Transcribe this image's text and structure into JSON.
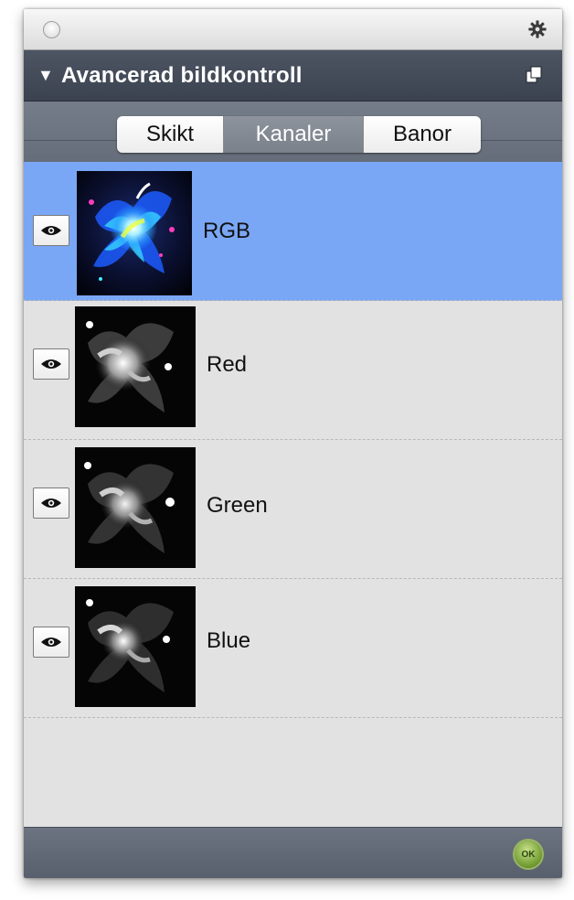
{
  "panel": {
    "title": "Avancerad bildkontroll",
    "ok_label": "OK"
  },
  "tabs": [
    {
      "label": "Skikt",
      "active": false
    },
    {
      "label": "Kanaler",
      "active": true
    },
    {
      "label": "Banor",
      "active": false
    }
  ],
  "channels": [
    {
      "label": "RGB",
      "visible": true,
      "selected": true
    },
    {
      "label": "Red",
      "visible": true,
      "selected": false
    },
    {
      "label": "Green",
      "visible": true,
      "selected": false
    },
    {
      "label": "Blue",
      "visible": true,
      "selected": false
    }
  ],
  "colors": {
    "selection": "#7aa7f5",
    "header_bg": "#434a57",
    "ok_green": "#6e9a2e"
  }
}
